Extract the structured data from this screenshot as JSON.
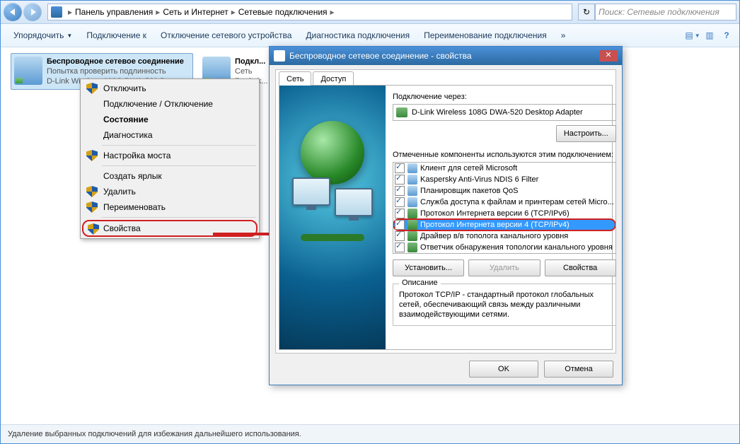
{
  "breadcrumb": {
    "parts": [
      "Панель управления",
      "Сеть и Интернет",
      "Сетевые подключения"
    ]
  },
  "search": {
    "placeholder": "Поиск: Сетевые подключения"
  },
  "toolbar": {
    "organize": "Упорядочить",
    "connect": "Подключение к",
    "disable": "Отключение сетевого устройства",
    "diagnose": "Диагностика подключения",
    "rename": "Переименование подключения"
  },
  "connections": {
    "wifi": {
      "name": "Беспроводное сетевое соединение",
      "status": "Попытка проверить подлинность",
      "device": "D-Link Wireless 108G DWA-520 De..."
    },
    "lan": {
      "name": "Подкл...",
      "status": "Сеть",
      "device": "Realtek..."
    }
  },
  "context_menu": {
    "disable": "Отключить",
    "toggle": "Подключение / Отключение",
    "status": "Состояние",
    "diag": "Диагностика",
    "bridge": "Настройка моста",
    "shortcut": "Создать ярлык",
    "delete": "Удалить",
    "rename": "Переименовать",
    "properties": "Свойства"
  },
  "dialog": {
    "title": "Беспроводное сетевое соединение - свойства",
    "tabs": {
      "network": "Сеть",
      "access": "Доступ"
    },
    "connect_via": "Подключение через:",
    "adapter": "D-Link Wireless 108G DWA-520 Desktop Adapter",
    "configure": "Настроить...",
    "components_label": "Отмеченные компоненты используются этим подключением:",
    "components": [
      "Клиент для сетей Microsoft",
      "Kaspersky Anti-Virus NDIS 6 Filter",
      "Планировщик пакетов QoS",
      "Служба доступа к файлам и принтерам сетей Micro...",
      "Протокол Интернета версии 6 (TCP/IPv6)",
      "Протокол Интернета версии 4 (TCP/IPv4)",
      "Драйвер в/в тополога канального уровня",
      "Ответчик обнаружения топологии канального уровня"
    ],
    "install": "Установить...",
    "uninstall": "Удалить",
    "props": "Свойства",
    "desc_title": "Описание",
    "desc_text": "Протокол TCP/IP - стандартный протокол глобальных сетей, обеспечивающий связь между различными взаимодействующими сетями.",
    "ok": "OK",
    "cancel": "Отмена"
  },
  "status_bar": "Удаление выбранных подключений для избежания дальнейшего использования."
}
